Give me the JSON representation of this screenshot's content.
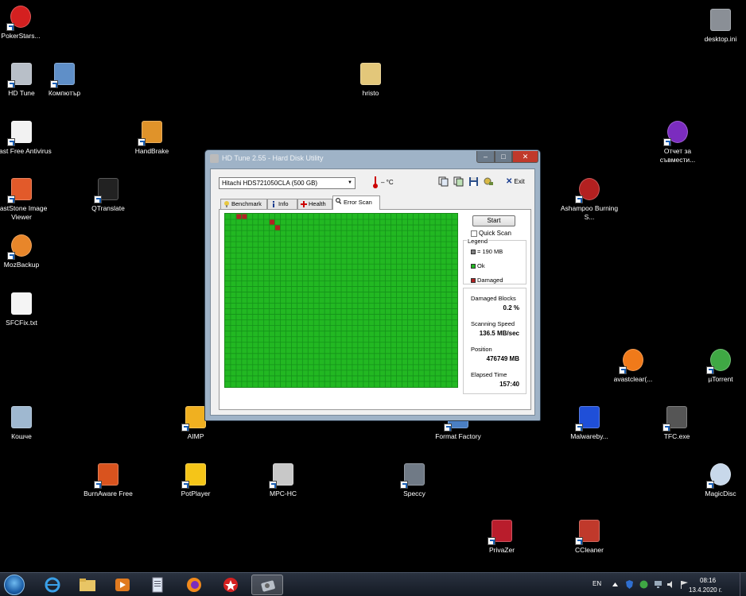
{
  "desktop": {
    "icons": [
      {
        "id": "pokerstars",
        "label": "PokerStars...",
        "icon": "pokerstars-icon"
      },
      {
        "id": "desktop-ini",
        "label": "desktop.ini",
        "icon": "settings-file-icon"
      },
      {
        "id": "hdtune",
        "label": "HD Tune",
        "icon": "hdtune-icon"
      },
      {
        "id": "computer",
        "label": "Компютър",
        "icon": "computer-icon"
      },
      {
        "id": "hristo",
        "label": "hristo",
        "icon": "user-folder-icon"
      },
      {
        "id": "avast-free",
        "label": "Avast Free Antivirus",
        "icon": "file-icon"
      },
      {
        "id": "handbrake",
        "label": "HandBrake",
        "icon": "handbrake-icon"
      },
      {
        "id": "otchet",
        "label": "Отчет за съвмести...",
        "icon": "firefox-doc-icon"
      },
      {
        "id": "faststone",
        "label": "FastStone Image Viewer",
        "icon": "faststone-icon"
      },
      {
        "id": "qtranslate",
        "label": "QTranslate",
        "icon": "qtranslate-icon"
      },
      {
        "id": "ashampoo",
        "label": "Ashampoo Burning S...",
        "icon": "ashampoo-icon"
      },
      {
        "id": "mozbackup",
        "label": "MozBackup",
        "icon": "mozbackup-icon"
      },
      {
        "id": "sfcfix",
        "label": "SFCFix.txt",
        "icon": "text-file-icon"
      },
      {
        "id": "avastclear",
        "label": "avastclear(...",
        "icon": "avast-icon"
      },
      {
        "id": "utorrent",
        "label": "µTorrent",
        "icon": "utorrent-icon"
      },
      {
        "id": "recycle",
        "label": "Кошче",
        "icon": "recycle-bin-icon"
      },
      {
        "id": "aimp",
        "label": "AIMP",
        "icon": "aimp-icon"
      },
      {
        "id": "format-factory",
        "label": "Format Factory",
        "icon": "format-factory-icon"
      },
      {
        "id": "malwarebytes",
        "label": "Malwareby...",
        "icon": "malwarebytes-icon"
      },
      {
        "id": "tfc",
        "label": "TFC.exe",
        "icon": "tfc-icon"
      },
      {
        "id": "burnaware",
        "label": "BurnAware Free",
        "icon": "burnaware-icon"
      },
      {
        "id": "potplayer",
        "label": "PotPlayer",
        "icon": "potplayer-icon"
      },
      {
        "id": "mpchc",
        "label": "MPC-HC",
        "icon": "mpc-hc-icon"
      },
      {
        "id": "speccy",
        "label": "Speccy",
        "icon": "speccy-icon"
      },
      {
        "id": "magicdisc",
        "label": "MagicDisc",
        "icon": "magicdisc-icon"
      },
      {
        "id": "privazer",
        "label": "PrivaZer",
        "icon": "privazer-icon"
      },
      {
        "id": "ccleaner",
        "label": "CCleaner",
        "icon": "ccleaner-icon"
      }
    ]
  },
  "window": {
    "title": "HD Tune 2.55 - Hard Disk Utility",
    "drive": "Hitachi HDS721050CLA (500 GB)",
    "temperature": "– °C",
    "exit_label": "Exit",
    "tabs": [
      {
        "label": "Benchmark",
        "icon": "benchmark-icon"
      },
      {
        "label": "Info",
        "icon": "info-icon"
      },
      {
        "label": "Health",
        "icon": "health-icon"
      },
      {
        "label": "Error Scan",
        "icon": "error-scan-icon"
      }
    ],
    "active_tab": "Error Scan",
    "error_scan": {
      "start_label": "Start",
      "quick_scan_label": "Quick Scan",
      "quick_scan_checked": false,
      "legend_title": "Legend",
      "legend": [
        {
          "label": "= 190 MB",
          "color": "#808080"
        },
        {
          "label": "Ok",
          "color": "#22b822"
        },
        {
          "label": "Damaged",
          "color": "#b22222"
        }
      ],
      "stats": [
        {
          "label": "Damaged Blocks",
          "value": "0.2 %"
        },
        {
          "label": "Scanning Speed",
          "value": "136.5 MB/sec"
        },
        {
          "label": "Position",
          "value": "476749 MB"
        },
        {
          "label": "Elapsed Time",
          "value": "157:40"
        }
      ],
      "block_map": {
        "columns": 42,
        "rows": 31,
        "ok_color": "#22b822",
        "damaged_color": "#b22222",
        "damaged_blocks": [
          [
            0,
            2
          ],
          [
            0,
            3
          ],
          [
            1,
            8
          ],
          [
            2,
            9
          ]
        ]
      }
    }
  },
  "taskbar": {
    "items": [
      {
        "id": "explorer-ie",
        "icon": "internet-explorer-icon"
      },
      {
        "id": "explorer",
        "icon": "folder-icon"
      },
      {
        "id": "media",
        "icon": "media-player-icon"
      },
      {
        "id": "notes",
        "icon": "notepad-icon"
      },
      {
        "id": "firefox",
        "icon": "firefox-icon"
      },
      {
        "id": "pokerstars",
        "icon": "pokerstars-icon"
      },
      {
        "id": "hdtune",
        "icon": "hdtune-icon",
        "active": true
      }
    ],
    "language": "EN",
    "time": "08:16",
    "date": "13.4.2020 г."
  }
}
